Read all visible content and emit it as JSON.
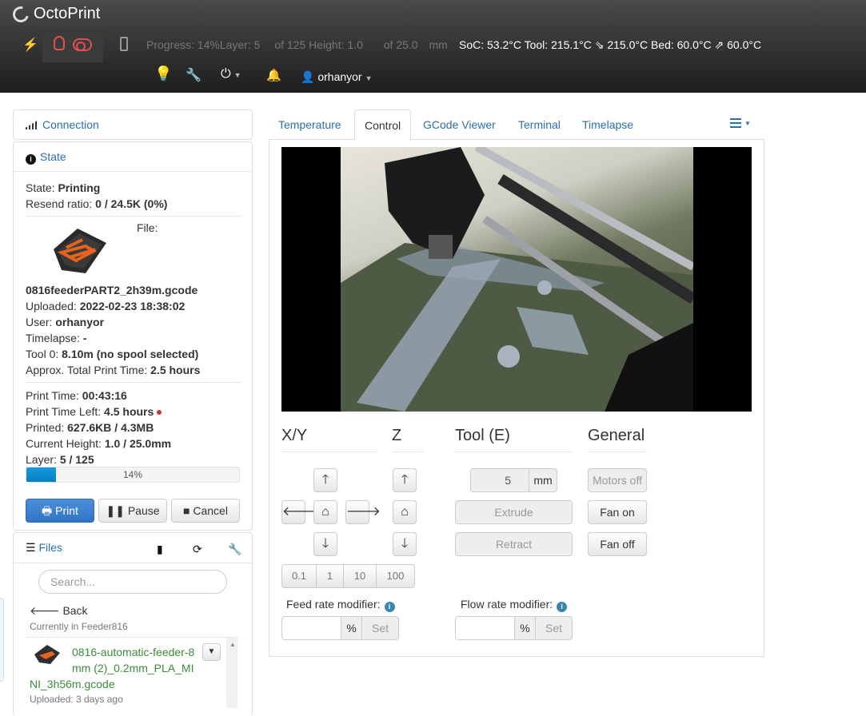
{
  "navbar": {
    "brand": "OctoPrint",
    "status": {
      "progress": "Progress: 14%",
      "layer": "Layer: 5",
      "of_layer": "of 125",
      "height": "Height: 1.0",
      "of_height": "of 25.0",
      "unit": "mm",
      "temps": "SoC: 53.2°C Tool: 215.1°C ⇘ 215.0°C Bed: 60.0°C ⇗ 60.0°C"
    },
    "user": "orhanyor"
  },
  "connection": {
    "title": "Connection"
  },
  "state": {
    "title": "State",
    "state_label": "State: ",
    "state_value": "Printing",
    "resend_label": "Resend ratio: ",
    "resend_value": "0 / 24.5K (0%)",
    "file_label": "File:",
    "filename": "0816feederPART2_2h39m.gcode",
    "uploaded_label": "Uploaded: ",
    "uploaded_value": "2022-02-23 18:38:02",
    "user_label": "User: ",
    "user_value": "orhanyor",
    "timelapse_label": "Timelapse: ",
    "timelapse_value": "-",
    "tool_label": "Tool 0: ",
    "tool_value": "8.10m (no spool selected)",
    "approx_label": "Approx. Total Print Time: ",
    "approx_value": "2.5 hours",
    "printtime_label": "Print Time: ",
    "printtime_value": "00:43:16",
    "timeleft_label": "Print Time Left: ",
    "timeleft_value": "4.5 hours",
    "printed_label": "Printed: ",
    "printed_value": "627.6KB / 4.3MB",
    "height_label": "Current Height: ",
    "height_value": "1.0 / 25.0mm",
    "layer_label": "Layer: ",
    "layer_value": "5 / 125",
    "progress_fraction": 0.14,
    "progress_text": "14%",
    "print_button": "Print",
    "pause_button": "Pause",
    "cancel_button": "Cancel"
  },
  "files": {
    "title": "Files",
    "search_placeholder": "Search...",
    "back": "Back",
    "current_folder": "Currently in Feeder816",
    "item_name_1": "0816-automatic-feeder-8",
    "item_name_2": "mm (2)_0.2mm_PLA_MI",
    "item_name_3": "NI_3h56m.gcode",
    "item_uploaded": "Uploaded: 3 days ago"
  },
  "tabs": [
    "Temperature",
    "Control",
    "GCode Viewer",
    "Terminal",
    "Timelapse"
  ],
  "control": {
    "xy_title": "X/Y",
    "z_title": "Z",
    "tool_title": "Tool (E)",
    "general_title": "General",
    "steps": [
      "0.1",
      "1",
      "10",
      "100"
    ],
    "extrude_amount": "5",
    "extrude_unit": "mm",
    "extrude_button": "Extrude",
    "retract_button": "Retract",
    "motors_off": "Motors off",
    "fan_on": "Fan on",
    "fan_off": "Fan off",
    "feed_label": "Feed rate modifier:",
    "flow_label": "Flow rate modifier:",
    "percent": "%",
    "set": "Set"
  },
  "colors": {
    "accent": "#2b6ea9",
    "progress": "#0480be",
    "primary_button": "#3174c7"
  }
}
